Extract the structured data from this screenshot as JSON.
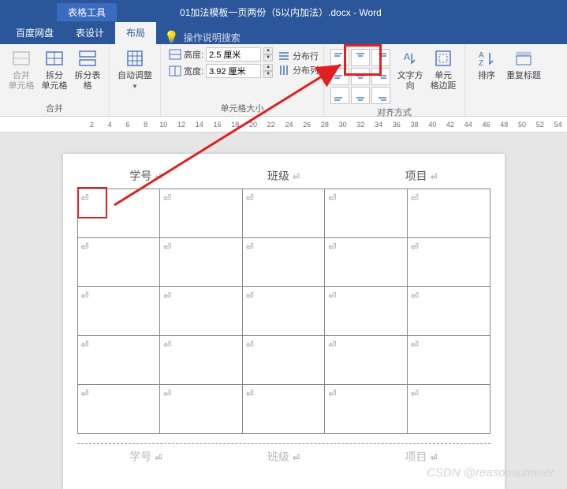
{
  "title_bar": {
    "contextual_title": "表格工具",
    "document_title": "01加法模板一页两份（5以内加法）.docx - Word"
  },
  "tabs": {
    "baidupan": "百度网盘",
    "table_design": "表设计",
    "layout": "布局",
    "tell_me": "操作说明搜索"
  },
  "ribbon": {
    "merge": {
      "merge_cells": "合并\n单元格",
      "split_cells": "拆分\n单元格",
      "split_table": "拆分表格",
      "group": "合并"
    },
    "autofit": "自动调整",
    "cell_size": {
      "height_label": "高度:",
      "height_value": "2.5 厘米",
      "width_label": "宽度:",
      "width_value": "3.92 厘米",
      "group": "单元格大小"
    },
    "distribute": {
      "rows": "分布行",
      "cols": "分布列"
    },
    "alignment": {
      "text_direction": "文字方向",
      "cell_margins": "单元\n格边距",
      "group": "对齐方式"
    },
    "sort": "排序",
    "repeat_header": "重复标题"
  },
  "ruler": [
    "2",
    "4",
    "6",
    "8",
    "10",
    "12",
    "14",
    "16",
    "18",
    "20",
    "22",
    "24",
    "26",
    "28",
    "30",
    "32",
    "34",
    "36",
    "38",
    "40",
    "42",
    "44",
    "46",
    "48",
    "50",
    "52",
    "54"
  ],
  "doc": {
    "header_labels": [
      "学号",
      "班级",
      "项目"
    ],
    "footer_labels": [
      "学号",
      "班级",
      "项目"
    ]
  },
  "watermark": "CSDN @reasonsummer"
}
